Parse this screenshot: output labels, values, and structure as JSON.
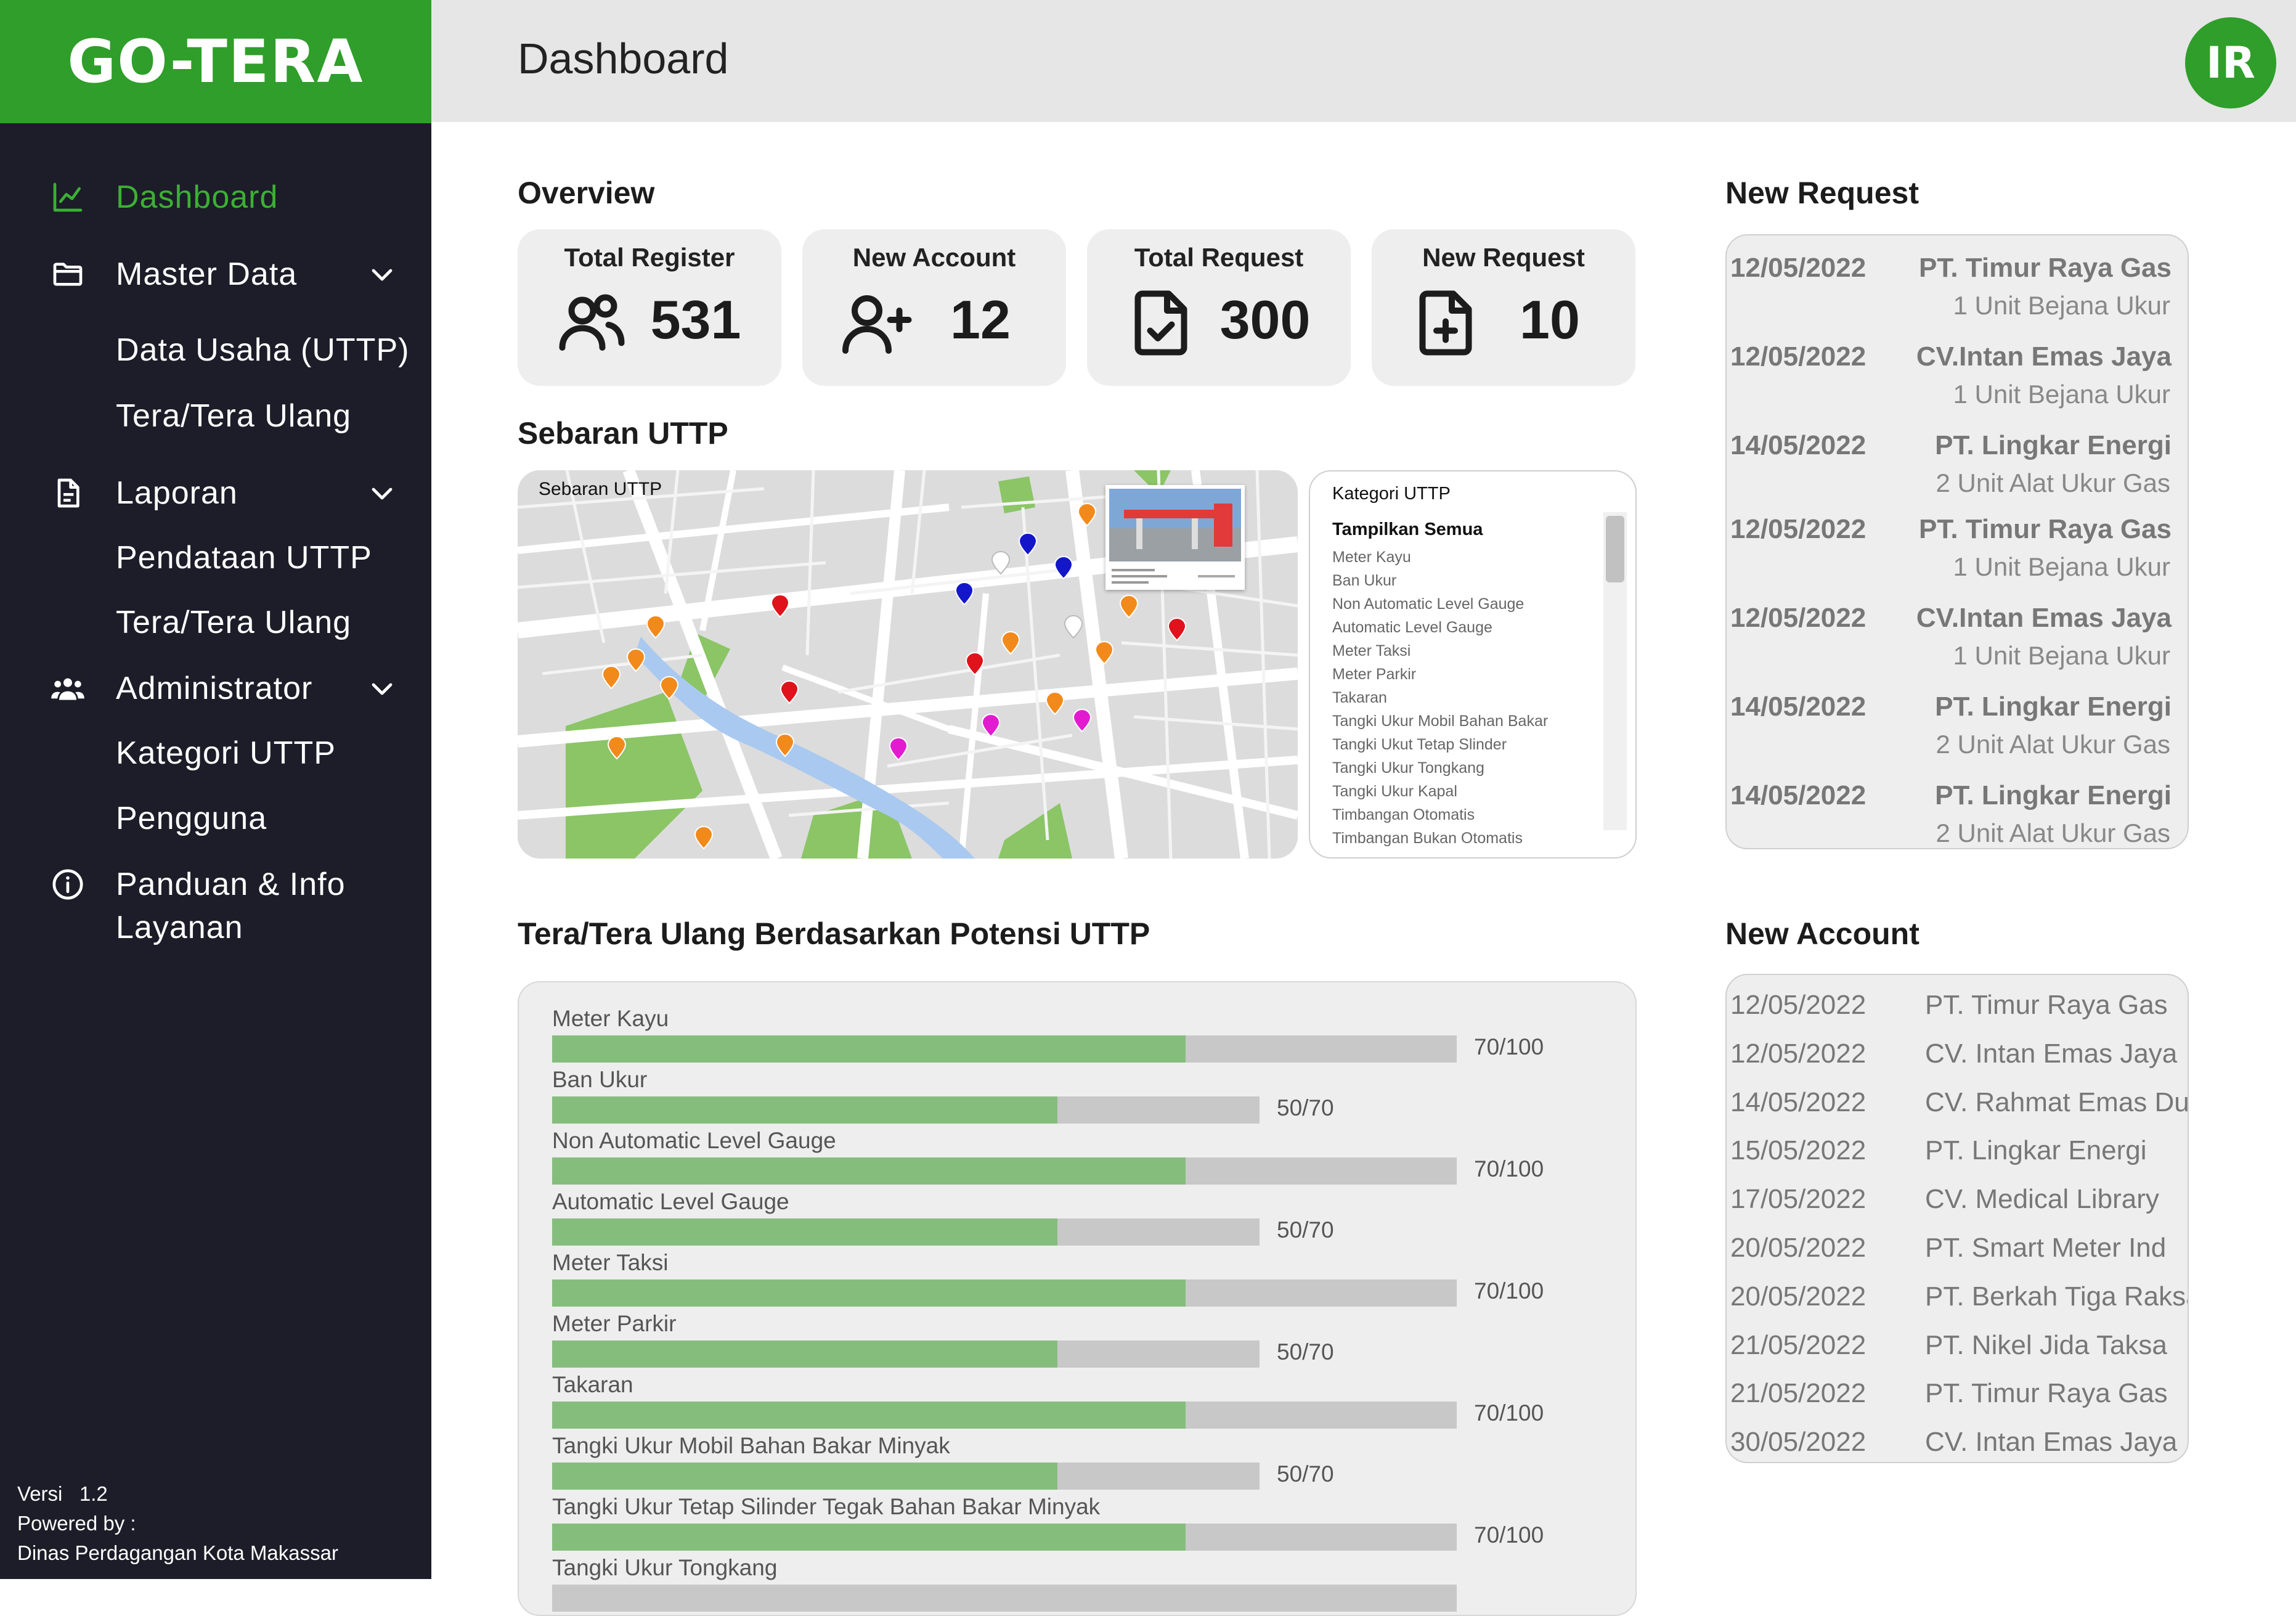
{
  "app": {
    "brand": "GO-TERA",
    "page_title": "Dashboard",
    "user_initials": "IR"
  },
  "sidebar": {
    "dashboard": "Dashboard",
    "master_data": "Master Data",
    "master_data_items": [
      "Data Usaha (UTTP)",
      "Tera/Tera Ulang"
    ],
    "laporan": "Laporan",
    "laporan_items": [
      "Pendataan UTTP",
      "Tera/Tera Ulang"
    ],
    "administrator": "Administrator",
    "administrator_items": [
      "Kategori UTTP",
      "Pengguna"
    ],
    "panduan_line1": "Panduan & Info",
    "panduan_line2": "Layanan",
    "version_line": "Versi   1.2",
    "powered_by": "Powered by :",
    "org": "Dinas Perdagangan Kota Makassar"
  },
  "overview": {
    "title": "Overview",
    "cards": [
      {
        "label": "Total Register",
        "value": "531",
        "icon": "users-icon"
      },
      {
        "label": "New Account",
        "value": "12",
        "icon": "user-plus-icon"
      },
      {
        "label": "Total Request",
        "value": "300",
        "icon": "file-check-icon"
      },
      {
        "label": "New Request",
        "value": "10",
        "icon": "file-plus-icon"
      }
    ]
  },
  "sebaran": {
    "title": "Sebaran UTTP",
    "map_label": "Sebaran UTTP",
    "kategori_title": "Kategori UTTP",
    "kategori_all": "Tampilkan Semua",
    "kategori_items": [
      "Meter Kayu",
      "Ban Ukur",
      "Non Automatic Level Gauge",
      "Automatic Level Gauge",
      "Meter Taksi",
      "Meter Parkir",
      "Takaran",
      "Tangki Ukur Mobil Bahan Bakar",
      "Tangki Ukut Tetap Slinder",
      "Tangki Ukur Tongkang",
      "Tangki Ukur Kapal",
      "Timbangan Otomatis",
      "Timbangan Bukan Otomatis"
    ],
    "marker_colors": {
      "orange": "#f28a1b",
      "red": "#e0121b",
      "blue": "#1417c9",
      "magenta": "#e31bd0",
      "white": "#ffffff"
    }
  },
  "tera": {
    "title": "Tera/Tera Ulang Berdasarkan Potensi UTTP",
    "rows": [
      {
        "name": "Meter Kayu",
        "label": "70/100",
        "value": 70,
        "max": 100
      },
      {
        "name": "Ban Ukur",
        "label": "50/70",
        "value": 50,
        "max": 70
      },
      {
        "name": "Non Automatic Level Gauge",
        "label": "70/100",
        "value": 70,
        "max": 100
      },
      {
        "name": "Automatic Level Gauge",
        "label": "50/70",
        "value": 50,
        "max": 70
      },
      {
        "name": "Meter Taksi",
        "label": "70/100",
        "value": 70,
        "max": 100
      },
      {
        "name": "Meter Parkir",
        "label": "50/70",
        "value": 50,
        "max": 70
      },
      {
        "name": "Takaran",
        "label": "70/100",
        "value": 70,
        "max": 100
      },
      {
        "name": "Tangki Ukur Mobil Bahan Bakar Minyak",
        "label": "50/70",
        "value": 50,
        "max": 70
      },
      {
        "name": "Tangki Ukur Tetap Silinder Tegak Bahan Bakar Minyak",
        "label": "70/100",
        "value": 70,
        "max": 100
      },
      {
        "name": "Tangki Ukur Tongkang",
        "label": "",
        "value": 0,
        "max": 100
      }
    ]
  },
  "new_request": {
    "title": "New Request",
    "rows": [
      {
        "date": "12/05/2022",
        "company": "PT. Timur Raya Gas",
        "item": "1 Unit Bejana Ukur"
      },
      {
        "date": "12/05/2022",
        "company": "CV.Intan Emas Jaya",
        "item": "1 Unit Bejana Ukur"
      },
      {
        "date": "14/05/2022",
        "company": "PT. Lingkar Energi",
        "item": "2 Unit Alat Ukur Gas"
      },
      {
        "date": "12/05/2022",
        "company": "PT. Timur Raya Gas",
        "item": "1 Unit Bejana Ukur"
      },
      {
        "date": "12/05/2022",
        "company": "CV.Intan Emas Jaya",
        "item": "1 Unit Bejana Ukur"
      },
      {
        "date": "14/05/2022",
        "company": "PT. Lingkar Energi",
        "item": "2 Unit Alat Ukur Gas"
      },
      {
        "date": "14/05/2022",
        "company": "PT. Lingkar Energi",
        "item": "2 Unit Alat Ukur Gas"
      }
    ]
  },
  "new_account": {
    "title": "New Account",
    "rows": [
      {
        "date": "12/05/2022",
        "company": "PT. Timur Raya Gas"
      },
      {
        "date": "12/05/2022",
        "company": "CV. Intan Emas Jaya"
      },
      {
        "date": "14/05/2022",
        "company": "CV. Rahmat Emas Dua"
      },
      {
        "date": "15/05/2022",
        "company": "PT. Lingkar Energi"
      },
      {
        "date": "17/05/2022",
        "company": "CV. Medical Library"
      },
      {
        "date": "20/05/2022",
        "company": "PT. Smart Meter Ind"
      },
      {
        "date": "20/05/2022",
        "company": "PT. Berkah Tiga Raksa"
      },
      {
        "date": "21/05/2022",
        "company": "PT. Nikel Jida Taksa"
      },
      {
        "date": "21/05/2022",
        "company": "PT. Timur Raya Gas"
      },
      {
        "date": "30/05/2022",
        "company": "CV. Intan Emas Jaya"
      }
    ]
  },
  "colors": {
    "brand_green": "#2f9e2a",
    "sidebar_bg": "#1c1d28",
    "bar_fill": "#85bd7d",
    "bar_track": "#c8c8c8"
  }
}
